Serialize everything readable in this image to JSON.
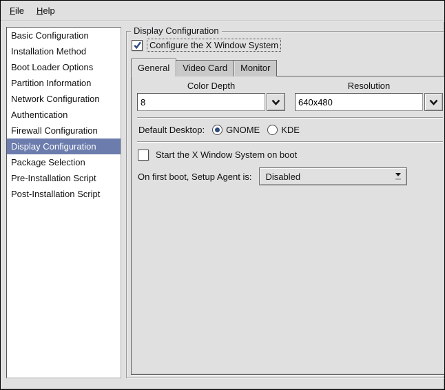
{
  "menubar": {
    "items": [
      {
        "label": "File"
      },
      {
        "label": "Help"
      }
    ]
  },
  "sidebar": {
    "selected_index": 7,
    "items": [
      {
        "label": "Basic Configuration"
      },
      {
        "label": "Installation Method"
      },
      {
        "label": "Boot Loader Options"
      },
      {
        "label": "Partition Information"
      },
      {
        "label": "Network Configuration"
      },
      {
        "label": "Authentication"
      },
      {
        "label": "Firewall Configuration"
      },
      {
        "label": "Display Configuration"
      },
      {
        "label": "Package Selection"
      },
      {
        "label": "Pre-Installation Script"
      },
      {
        "label": "Post-Installation Script"
      }
    ]
  },
  "panel": {
    "frame_title": "Display Configuration",
    "configure_x_checkbox": {
      "label": "Configure the X Window System",
      "checked": true
    },
    "notebook": {
      "active_tab": "General",
      "tabs": [
        {
          "label": "General"
        },
        {
          "label": "Video Card"
        },
        {
          "label": "Monitor"
        }
      ]
    },
    "general_tab": {
      "color_depth": {
        "label": "Color Depth",
        "value": "8"
      },
      "resolution": {
        "label": "Resolution",
        "value": "640x480"
      },
      "default_desktop": {
        "label": "Default Desktop:",
        "options": [
          {
            "label": "GNOME",
            "selected": true
          },
          {
            "label": "KDE",
            "selected": false
          }
        ]
      },
      "start_x_checkbox": {
        "label": "Start the X Window System on boot",
        "checked": false
      },
      "setup_agent": {
        "label": "On first boot, Setup Agent is:",
        "value": "Disabled"
      }
    }
  },
  "colors": {
    "background": "#e0e0e0",
    "selection_blue": "#6b7cad",
    "check_blue": "#2f4e86",
    "inactive_tab": "#c9c9c9"
  }
}
